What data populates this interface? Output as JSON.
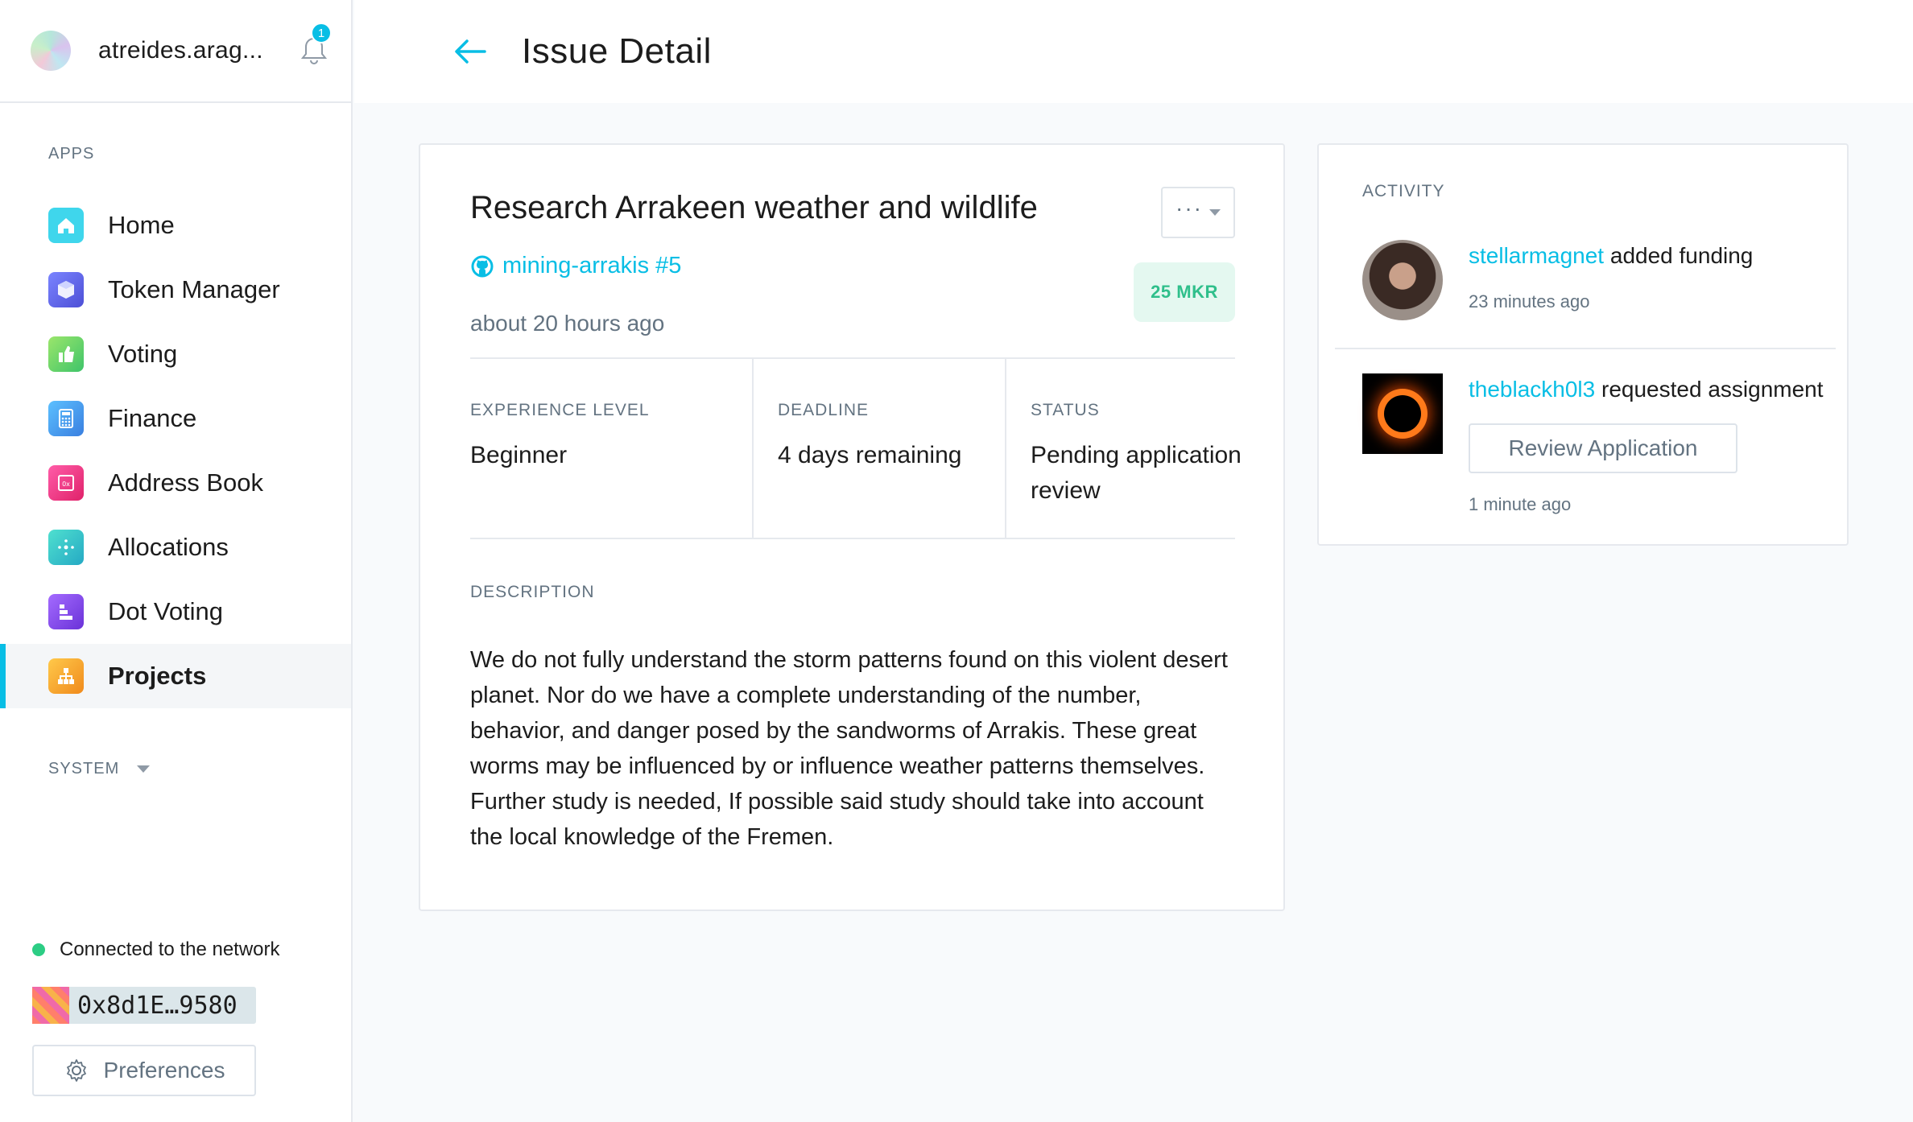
{
  "sidebar": {
    "org_name": "atreides.arag...",
    "notification_count": "1",
    "apps_label": "APPS",
    "items": [
      {
        "label": "Home",
        "icon": "home-icon",
        "color": "#3fd6ec"
      },
      {
        "label": "Token Manager",
        "icon": "token-manager-icon",
        "color": "#5b63e6"
      },
      {
        "label": "Voting",
        "icon": "voting-icon",
        "color": "#6ad26b"
      },
      {
        "label": "Finance",
        "icon": "finance-icon",
        "color": "#4aa3f0"
      },
      {
        "label": "Address Book",
        "icon": "address-book-icon",
        "color": "#f0328a"
      },
      {
        "label": "Allocations",
        "icon": "allocations-icon",
        "color": "#2fc6c9"
      },
      {
        "label": "Dot Voting",
        "icon": "dot-voting-icon",
        "color": "#7a4be0"
      },
      {
        "label": "Projects",
        "icon": "projects-icon",
        "color": "#f5a623",
        "active": true
      }
    ],
    "system_label": "SYSTEM",
    "network_status": "Connected to the network",
    "account_address": "0x8d1E…9580",
    "preferences_label": "Preferences"
  },
  "header": {
    "title": "Issue Detail"
  },
  "issue": {
    "title": "Research Arrakeen weather and wildlife",
    "menu_dots": "···",
    "repo_link": "mining-arrakis #5",
    "created": "about 20 hours ago",
    "bounty": "25 MKR",
    "experience_label": "EXPERIENCE LEVEL",
    "experience_value": "Beginner",
    "deadline_label": "DEADLINE",
    "deadline_value": "4 days remaining",
    "status_label": "STATUS",
    "status_value": "Pending application review",
    "description_label": "DESCRIPTION",
    "description": "We do not fully understand the storm patterns found on this violent desert planet. Nor do we have a complete understanding of the number, behavior, and danger posed by the sandworms of Arrakis. These great worms may be influenced by or influence weather patterns themselves. Further study is needed, If possible said study should take into account the local knowledge of the Fremen."
  },
  "activity": {
    "label": "ACTIVITY",
    "items": [
      {
        "user": "stellarmagnet",
        "action": " added funding",
        "time": "23 minutes ago"
      },
      {
        "user": "theblackh0l3",
        "action": " requested assignment",
        "button": "Review Application",
        "time": "1 minute ago"
      }
    ]
  },
  "colors": {
    "accent": "#08bee5",
    "bounty_bg": "#e4f8f0",
    "bounty_text": "#2fbf8b",
    "network_ok": "#2ccd84"
  }
}
